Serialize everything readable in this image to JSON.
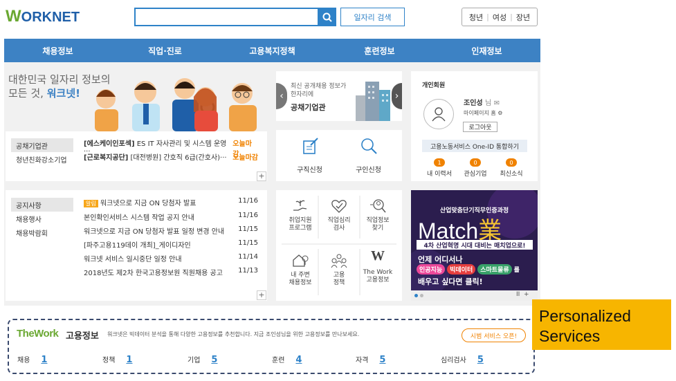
{
  "header": {
    "logo": "WORKNET",
    "search_placeholder": "",
    "job_search_button": "일자리 검색",
    "user_types": [
      "청년",
      "여성",
      "장년"
    ]
  },
  "nav": [
    "채용정보",
    "직업·진로",
    "고용복지정책",
    "훈련정보",
    "인재정보"
  ],
  "hero": {
    "line1": "대한민국 일자리 정보의",
    "line2_prefix": "모든 것, ",
    "line2_brand": "워크넷!"
  },
  "job_list": {
    "tabs": [
      "공채기업관",
      "청년친화강소기업"
    ],
    "rows": [
      {
        "company": "[에스케이인포섹]",
        "title": "ES IT 자사관리 및 시스템 운영···",
        "status": "오늘마감"
      },
      {
        "company": "[근로복지공단]",
        "title": "[대전병원] 간호직 6급(간호사)···",
        "status": "오늘마감"
      }
    ],
    "more": "+"
  },
  "public_enterprise": {
    "caption1": "최신 공개채용 정보가",
    "caption2": "한자리에",
    "title": "공채기업관"
  },
  "apply": {
    "items": [
      "구직신청",
      "구인신청"
    ]
  },
  "member": {
    "heading": "개인회원",
    "name": "조인성",
    "name_suffix": "님",
    "mypage": "마이페이지 홈",
    "logout": "로그아웃",
    "one_id": "고용노동서비스 One-ID 통합하기",
    "counts": [
      {
        "label": "내 이력서",
        "value": "1"
      },
      {
        "label": "관심기업",
        "value": "0"
      },
      {
        "label": "최신소식",
        "value": "0"
      }
    ]
  },
  "notice": {
    "tabs": [
      "공지사항",
      "채용행사",
      "채용박람회"
    ],
    "badge": "알림",
    "rows": [
      {
        "title": "워크넷으로 지금 ON 당첨자 발표",
        "date": "11/16"
      },
      {
        "title": "본인확인서비스 시스템 작업 공지 안내",
        "date": "11/16"
      },
      {
        "title": "워크넷으로 지금 ON 당첨자 발표 일정 변경 안내",
        "date": "11/15"
      },
      {
        "title": "[파주고용119데이 개최]_게이디자인",
        "date": "11/15"
      },
      {
        "title": "워크넷 서비스 일시중단 일정 안내",
        "date": "11/14"
      },
      {
        "title": "2018년도 제2차 한국고용정보원 직원채용 공고",
        "date": "11/13"
      }
    ],
    "more": "+"
  },
  "services": [
    {
      "l1": "취업지원",
      "l2": "프로그램"
    },
    {
      "l1": "직업심리",
      "l2": "검사"
    },
    {
      "l1": "직업정보",
      "l2": "찾기"
    },
    {
      "l1": "내 주변",
      "l2": "채용정보"
    },
    {
      "l1": "고용",
      "l2": "정책"
    },
    {
      "l1": "The Work",
      "l2": "고용정보"
    }
  ],
  "banner": {
    "top": "산업맞춤단기직무인증과정",
    "match": "Match",
    "match_char": "業",
    "ribbon": "4차 산업혁명 시대 대비는 매치업으로!",
    "line1": "언제 어디서나",
    "tags": [
      "인공지능",
      "빅데이터",
      "스마트물류"
    ],
    "tag_suffix": "를",
    "line3": "배우고 싶다면 클릭!",
    "controls": "II  +"
  },
  "thework": {
    "brand": "TheWork",
    "title": "고용정보",
    "desc": "워크넷은 빅데이터 분석을 통해 다양한 고용정보를 추천합니다. 지금 조인성님을 위한 고용정보를 만나보세요.",
    "pilot": "시범 서비스 오픈!",
    "stats": [
      {
        "label": "채용",
        "value": "1"
      },
      {
        "label": "정책",
        "value": "1"
      },
      {
        "label": "기업",
        "value": "5"
      },
      {
        "label": "훈련",
        "value": "4"
      },
      {
        "label": "자격",
        "value": "5"
      },
      {
        "label": "심리검사",
        "value": "5"
      }
    ]
  },
  "callout": {
    "line1": "Personalized",
    "line2": "Services"
  },
  "colors": {
    "brand_blue": "#3d82c4",
    "accent_orange": "#f08200",
    "callout_yellow": "#f7b500"
  }
}
